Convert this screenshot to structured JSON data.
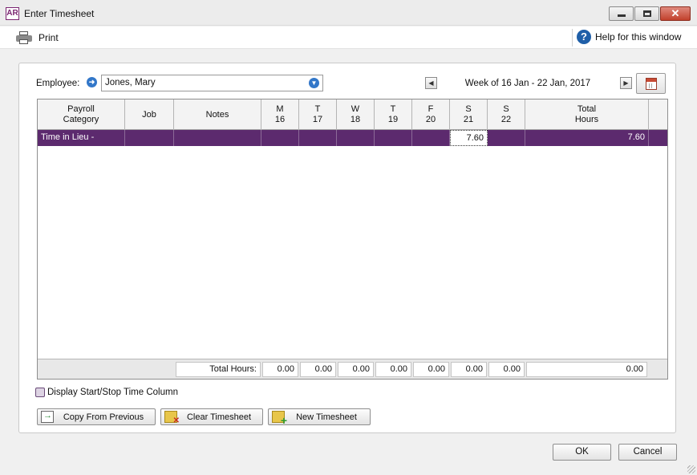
{
  "window": {
    "logo": "AR",
    "title": "Enter Timesheet",
    "close_glyph": "✕"
  },
  "toolbar": {
    "print_label": "Print",
    "help_label": "Help for this window",
    "help_glyph": "?"
  },
  "employee": {
    "label": "Employee:",
    "value": "Jones, Mary",
    "arrow_glyph": "➜",
    "dropdown_glyph": "▼"
  },
  "week": {
    "label": "Week of 16 Jan - 22 Jan, 2017",
    "prev_glyph": "◀",
    "next_glyph": "▶"
  },
  "grid": {
    "columns": [
      "Payroll\nCategory",
      "Job",
      "Notes",
      "M\n16",
      "T\n17",
      "W\n18",
      "T\n19",
      "F\n20",
      "S\n21",
      "S\n22",
      "Total\nHours"
    ],
    "rows": [
      {
        "category": "Time in Lieu - Earned",
        "job": "",
        "notes": "",
        "days": [
          "",
          "",
          "",
          "",
          "",
          "7.60",
          ""
        ],
        "total": "7.60"
      }
    ],
    "totals": {
      "label": "Total Hours:",
      "days": [
        "0.00",
        "0.00",
        "0.00",
        "0.00",
        "0.00",
        "0.00",
        "0.00"
      ],
      "total": "0.00"
    }
  },
  "options": {
    "start_stop_label": "Display Start/Stop Time Column",
    "start_stop_checked": false
  },
  "actions": {
    "copy_label": "Copy From Previous",
    "clear_label": "Clear Timesheet",
    "new_label": "New Timesheet"
  },
  "dialog": {
    "ok_label": "OK",
    "cancel_label": "Cancel"
  },
  "colors": {
    "selected_row": "#5c2a6e",
    "brand": "#7a2470",
    "link_blue": "#3277c9"
  }
}
